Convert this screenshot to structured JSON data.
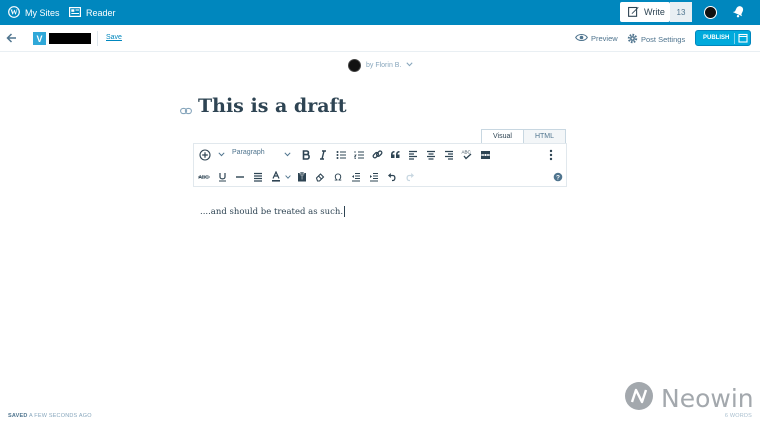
{
  "masterbar": {
    "my_sites": "My Sites",
    "reader": "Reader",
    "write": "Write",
    "notification_count": "13"
  },
  "editor_bar": {
    "site_icon_letter": "V",
    "save_label": "Save",
    "preview_label": "Preview",
    "post_settings_label": "Post Settings",
    "publish_label": "PUBLISH"
  },
  "post": {
    "author": "by Florin B.",
    "title": "This is a draft",
    "body": "....and should be treated as such."
  },
  "editor_tabs": {
    "visual": "Visual",
    "html": "HTML"
  },
  "toolbar": {
    "format_select": "Paragraph"
  },
  "footer": {
    "saved_prefix": "SAVED",
    "saved_time": "A FEW SECONDS AGO",
    "word_count": "6 WORDS"
  },
  "watermark": {
    "text": "Neowin"
  },
  "colors": {
    "masterbar": "#0087be",
    "accent": "#00aadc",
    "text": "#2e4453"
  }
}
